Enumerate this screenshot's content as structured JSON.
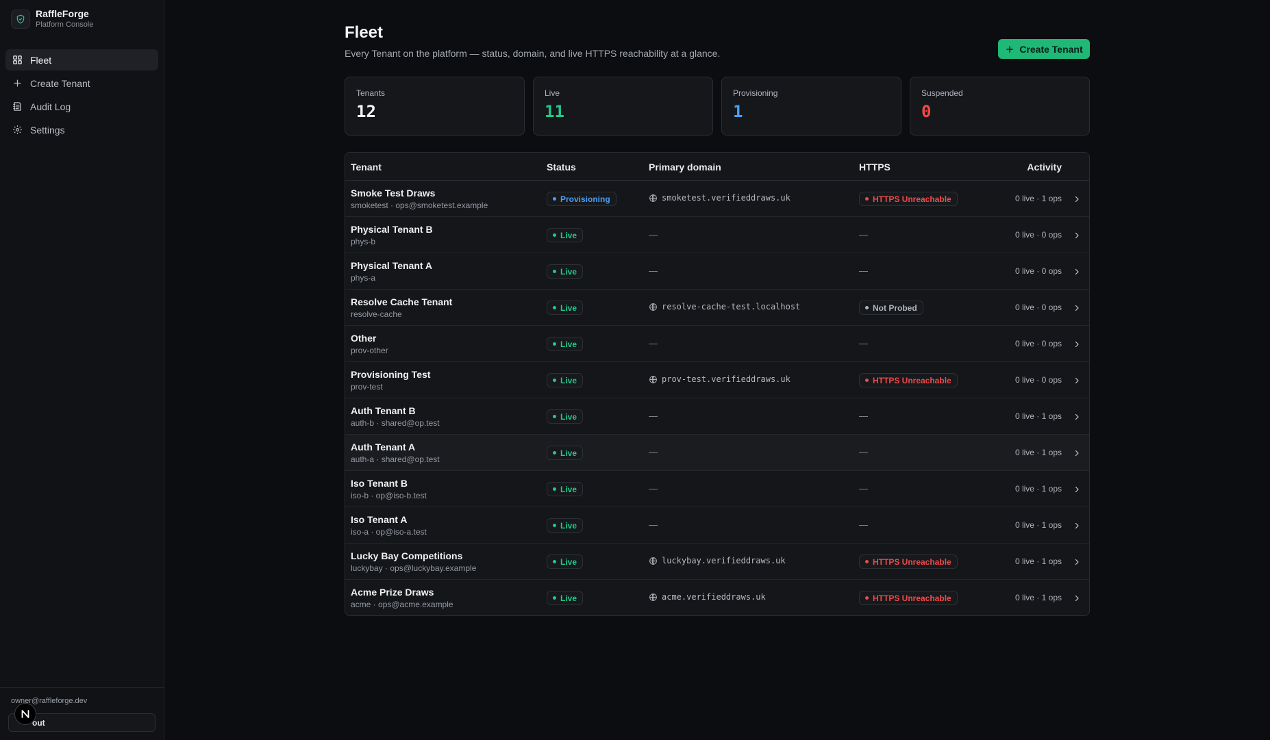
{
  "brand": {
    "name": "RaffleForge",
    "subtitle": "Platform Console"
  },
  "nav": [
    {
      "label": "Fleet",
      "icon": "grid-icon",
      "active": true
    },
    {
      "label": "Create Tenant",
      "icon": "plus-icon",
      "active": false
    },
    {
      "label": "Audit Log",
      "icon": "log-icon",
      "active": false
    },
    {
      "label": "Settings",
      "icon": "gear-icon",
      "active": false
    }
  ],
  "footer": {
    "email": "owner@raffleforge.dev",
    "signout_label": "out"
  },
  "page": {
    "title": "Fleet",
    "subtitle": "Every Tenant on the platform — status, domain, and live HTTPS reachability at a glance.",
    "create_label": "Create Tenant"
  },
  "stats": [
    {
      "label": "Tenants",
      "value": "12",
      "color": "#f4f5f7"
    },
    {
      "label": "Live",
      "value": "11",
      "color": "#22c98a"
    },
    {
      "label": "Provisioning",
      "value": "1",
      "color": "#4a9ff5"
    },
    {
      "label": "Suspended",
      "value": "0",
      "color": "#ef4a4a"
    }
  ],
  "table": {
    "headers": {
      "tenant": "Tenant",
      "status": "Status",
      "domain": "Primary domain",
      "https": "HTTPS",
      "activity": "Activity"
    },
    "rows": [
      {
        "name": "Smoke Test Draws",
        "meta": "smoketest · ops@smoketest.example",
        "status": "Provisioning",
        "domain": "smoketest.verifieddraws.uk",
        "https": "HTTPS Unreachable",
        "activity": "0 live · 1 ops"
      },
      {
        "name": "Physical Tenant B",
        "meta": "phys-b",
        "status": "Live",
        "domain": "",
        "https": "",
        "activity": "0 live · 0 ops"
      },
      {
        "name": "Physical Tenant A",
        "meta": "phys-a",
        "status": "Live",
        "domain": "",
        "https": "",
        "activity": "0 live · 0 ops"
      },
      {
        "name": "Resolve Cache Tenant",
        "meta": "resolve-cache",
        "status": "Live",
        "domain": "resolve-cache-test.localhost",
        "https": "Not Probed",
        "activity": "0 live · 0 ops"
      },
      {
        "name": "Other",
        "meta": "prov-other",
        "status": "Live",
        "domain": "",
        "https": "",
        "activity": "0 live · 0 ops"
      },
      {
        "name": "Provisioning Test",
        "meta": "prov-test",
        "status": "Live",
        "domain": "prov-test.verifieddraws.uk",
        "https": "HTTPS Unreachable",
        "activity": "0 live · 0 ops"
      },
      {
        "name": "Auth Tenant B",
        "meta": "auth-b · shared@op.test",
        "status": "Live",
        "domain": "",
        "https": "",
        "activity": "0 live · 1 ops"
      },
      {
        "name": "Auth Tenant A",
        "meta": "auth-a · shared@op.test",
        "status": "Live",
        "domain": "",
        "https": "",
        "activity": "0 live · 1 ops",
        "highlight": true
      },
      {
        "name": "Iso Tenant B",
        "meta": "iso-b · op@iso-b.test",
        "status": "Live",
        "domain": "",
        "https": "",
        "activity": "0 live · 1 ops"
      },
      {
        "name": "Iso Tenant A",
        "meta": "iso-a · op@iso-a.test",
        "status": "Live",
        "domain": "",
        "https": "",
        "activity": "0 live · 1 ops"
      },
      {
        "name": "Lucky Bay Competitions",
        "meta": "luckybay · ops@luckybay.example",
        "status": "Live",
        "domain": "luckybay.verifieddraws.uk",
        "https": "HTTPS Unreachable",
        "activity": "0 live · 1 ops"
      },
      {
        "name": "Acme Prize Draws",
        "meta": "acme · ops@acme.example",
        "status": "Live",
        "domain": "acme.verifieddraws.uk",
        "https": "HTTPS Unreachable",
        "activity": "0 live · 1 ops"
      }
    ],
    "empty_marker": "—"
  },
  "colors": {
    "accent": "#1fb877",
    "live": "#22c98a",
    "provisioning": "#4a9ff5",
    "unreachable": "#ef4a4a",
    "not_probed": "#b0b5bd"
  }
}
